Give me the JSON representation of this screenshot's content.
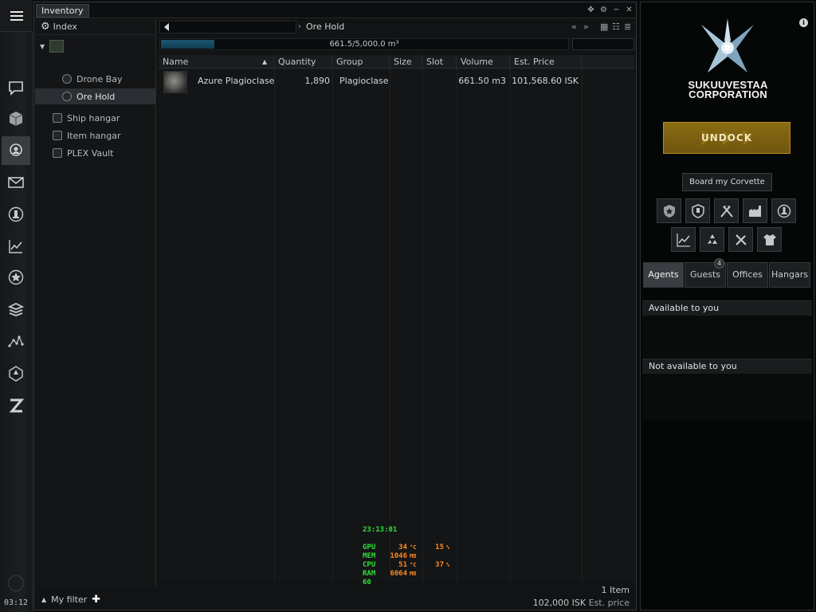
{
  "neocom": {
    "clock": "03:12",
    "buttons": [
      "menu-icon",
      "chat-icon",
      "inventory-cube-icon",
      "search-icon",
      "mail-icon",
      "industry-icon",
      "market-chart-icon",
      "agency-star-icon",
      "skills-stack-icon",
      "map-icon",
      "fitting-icon",
      "z-icon"
    ]
  },
  "window": {
    "title": "Inventory",
    "index_label": "Index",
    "tree": {
      "drone_bay": "Drone Bay",
      "ore_hold": "Ore Hold",
      "ship_hangar": "Ship hangar",
      "item_hangar": "Item hangar",
      "plex_vault": "PLEX Vault"
    },
    "path_label": "Ore Hold",
    "capacity": {
      "text": "661.5/5,000.0 m³",
      "fraction": 0.1323
    },
    "filter_label": "My filter",
    "columns": [
      "Name",
      "Quantity",
      "Group",
      "Size",
      "Slot",
      "Volume",
      "Est. Price"
    ],
    "rows": [
      {
        "name": "Azure Plagioclase",
        "quantity": "1,890",
        "group": "Plagioclase",
        "size": "",
        "slot": "",
        "volume": "661.50 m3",
        "price": "101,568.60 ISK"
      }
    ],
    "status_items": "1 Item",
    "status_price_value": "102,000 ISK",
    "status_price_label": "Est. price"
  },
  "overlay": {
    "time": "23:13:01",
    "rows": [
      {
        "k": "GPU",
        "v": "34",
        "u": "°C",
        "v2": "15",
        "u2": "%"
      },
      {
        "k": "MEM",
        "v": "1046",
        "u": "MB",
        "v2": "",
        "u2": ""
      },
      {
        "k": "CPU",
        "v": "51",
        "u": "°C",
        "v2": "37",
        "u2": "%"
      },
      {
        "k": "RAM",
        "v": "6064",
        "u": "MB",
        "v2": "",
        "u2": ""
      },
      {
        "k": "60",
        "v": "",
        "u": "",
        "v2": "",
        "u2": ""
      }
    ]
  },
  "station": {
    "corp_line1": "SUKUUVESTAA",
    "corp_line2": "CORPORATION",
    "undock": "UNDOCK",
    "board": "Board my Corvette",
    "tabs": [
      "Agents",
      "Guests",
      "Offices",
      "Hangars"
    ],
    "guests_count": "4",
    "available": "Available to you",
    "not_available": "Not available to you",
    "accent_gold": "#8a6c12",
    "capacity_bar_color": "#1c5772"
  }
}
